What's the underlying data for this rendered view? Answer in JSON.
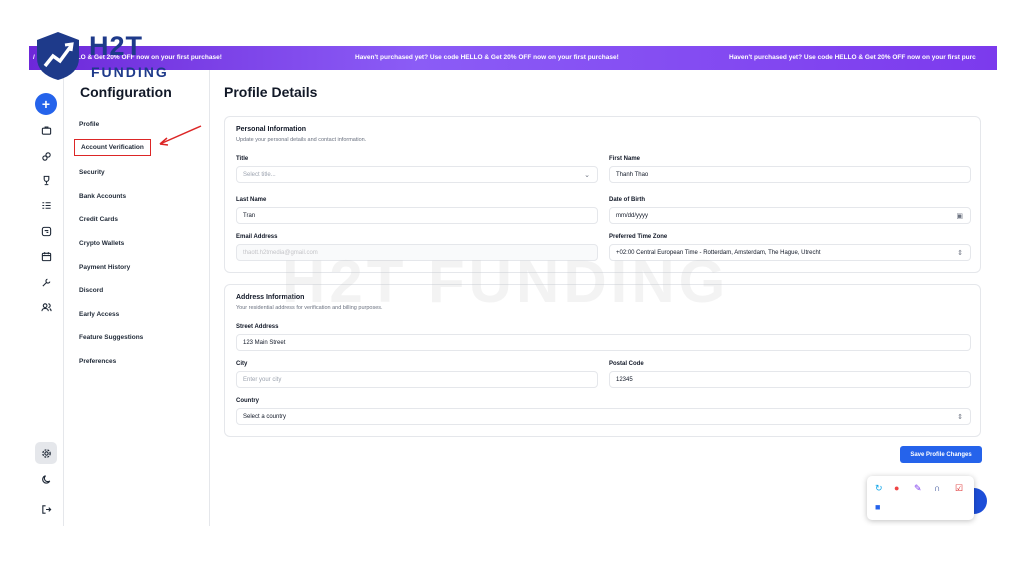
{
  "promo": {
    "msg1": "/ Us code HELLO & Get 20% OFF now on your first purchase!",
    "msg2": "Haven't purchased yet? Use code HELLO & Get 20% OFF now on your first purchase!",
    "msg3": "Haven't purchased yet? Use code HELLO & Get 20% OFF now on your first purc"
  },
  "logo": {
    "line1": "H2T",
    "line2": "FUNDING"
  },
  "watermark": "H2T FUNDING",
  "iconbar": {
    "add": "+",
    "icons": [
      "briefcase-icon",
      "link-icon",
      "trophy-icon",
      "list-icon",
      "exchange-icon",
      "calendar-icon",
      "wrench-icon",
      "users-icon",
      "gear-icon",
      "moon-icon",
      "logout-icon"
    ]
  },
  "sidebar": {
    "title": "Configuration",
    "items": [
      "Profile",
      "Account Verification",
      "Security",
      "Bank Accounts",
      "Credit Cards",
      "Crypto Wallets",
      "Payment History",
      "Discord",
      "Early Access",
      "Feature Suggestions",
      "Preferences"
    ]
  },
  "main": {
    "title": "Profile Details",
    "personal": {
      "title": "Personal Information",
      "subtitle": "Update your personal details and contact information.",
      "title_label": "Title",
      "title_placeholder": "Select title...",
      "first_name_label": "First Name",
      "first_name_value": "Thanh Thao",
      "last_name_label": "Last Name",
      "last_name_value": "Tran",
      "dob_label": "Date of Birth",
      "dob_placeholder": "mm/dd/yyyy",
      "email_label": "Email Address",
      "email_value": "thaott.h2tmedia@gmail.com",
      "tz_label": "Preferred Time Zone",
      "tz_value": "+02:00 Central European Time - Rotterdam, Amsterdam, The Hague, Utrecht"
    },
    "address": {
      "title": "Address Information",
      "subtitle": "Your residential address for verification and billing purposes.",
      "street_label": "Street Address",
      "street_value": "123 Main Street",
      "city_label": "City",
      "city_placeholder": "Enter your city",
      "postal_label": "Postal Code",
      "postal_value": "12345",
      "country_label": "Country",
      "country_placeholder": "Select a country"
    },
    "save_label": "Save Profile Changes"
  },
  "colors": {
    "accent": "#2563eb",
    "promo_start": "#6d28d9",
    "promo_end": "#7c3aed",
    "highlight": "#dc2626",
    "logo": "#1e3a8a"
  },
  "tray_icons": [
    "sync-icon",
    "chrome-icon",
    "pen-icon",
    "arc-icon",
    "checklist-icon",
    "app-icon"
  ]
}
